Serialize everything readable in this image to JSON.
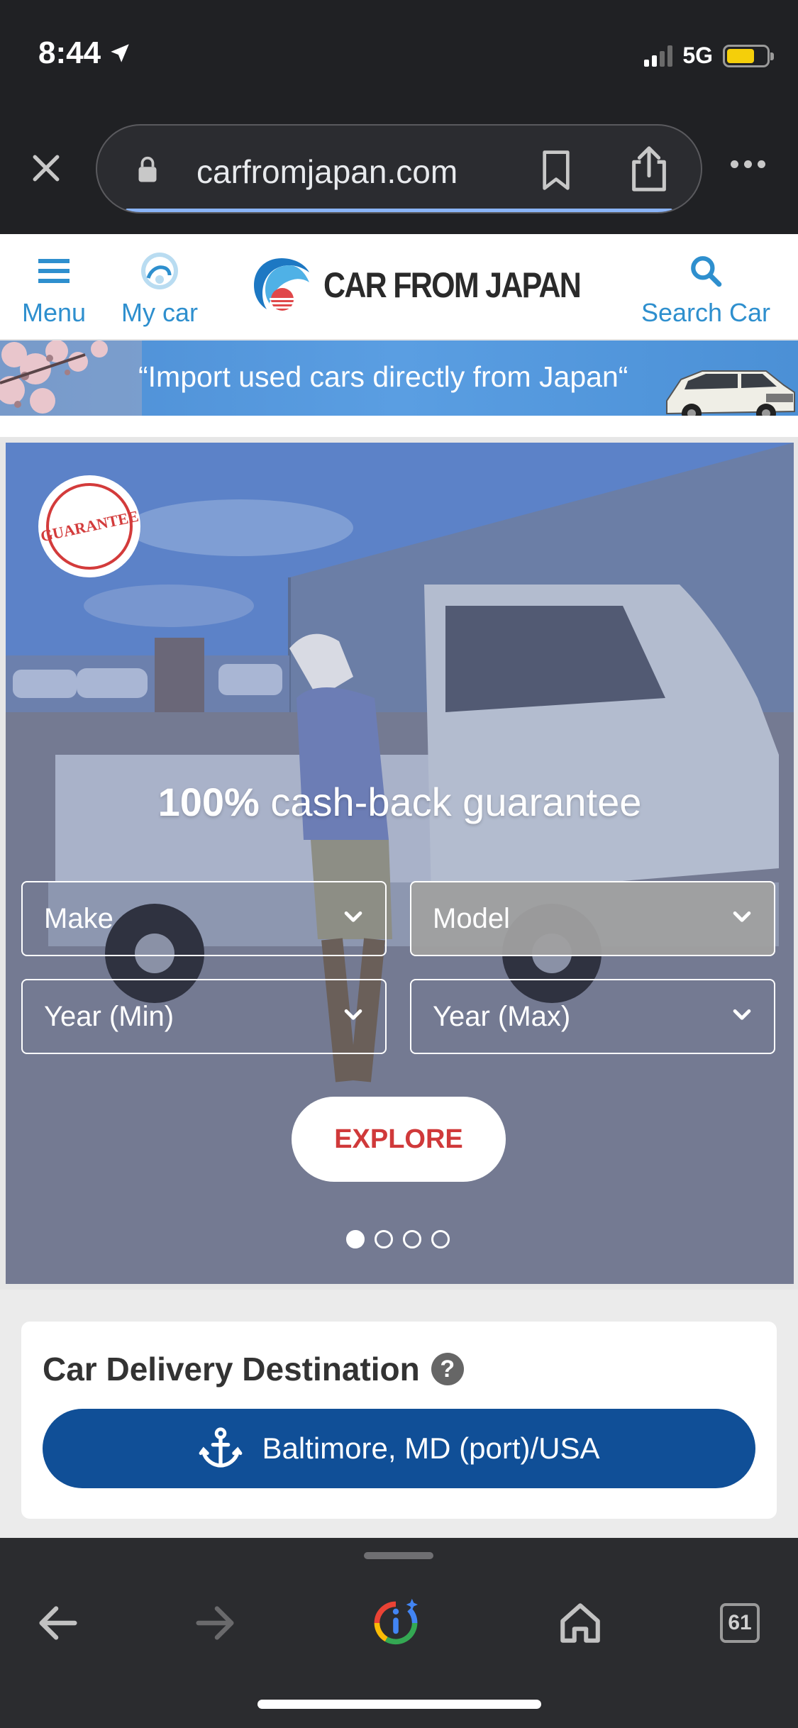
{
  "status_bar": {
    "time": "8:44",
    "network": "5G",
    "battery_percent": 70,
    "icons": [
      "location-arrow-icon",
      "signal-icon",
      "battery-icon"
    ]
  },
  "browser": {
    "url": "carfromjapan.com",
    "icons": [
      "close-icon",
      "lock-icon",
      "bookmark-icon",
      "share-icon",
      "more-icon"
    ]
  },
  "header": {
    "menu_label": "Menu",
    "mycar_label": "My car",
    "logo_text": "CAR FROM JAPAN",
    "search_label": "Search Car"
  },
  "banner": {
    "text": "“Import used cars directly from Japan“"
  },
  "hero": {
    "badge_text": "GUARANTEE",
    "headline_bold": "100%",
    "headline_rest": " cash-back guarantee",
    "make_placeholder": "Make",
    "model_placeholder": "Model",
    "year_min_placeholder": "Year (Min)",
    "year_max_placeholder": "Year (Max)",
    "explore_label": "EXPLORE",
    "slides_total": 4,
    "active_slide": 1
  },
  "delivery": {
    "title": "Car Delivery Destination",
    "help": "?",
    "port": "Baltimore, MD (port)/USA"
  },
  "toolbar": {
    "tab_count": "61",
    "icons": [
      "back-arrow-icon",
      "forward-arrow-icon",
      "google-assistant-icon",
      "home-icon",
      "tabs-icon"
    ]
  },
  "colors": {
    "brand_blue": "#2e8fce",
    "port_button": "#104f97",
    "explore_red": "#d0393a"
  }
}
